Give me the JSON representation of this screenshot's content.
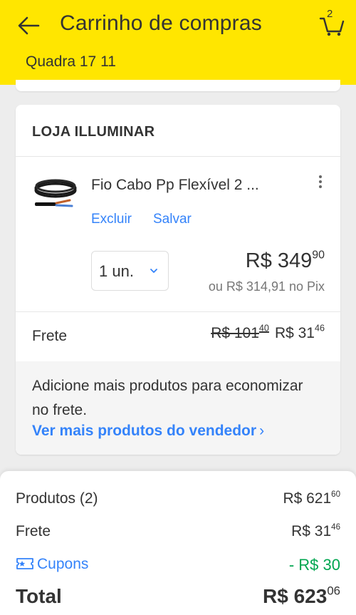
{
  "header": {
    "title": "Carrinho de compras",
    "cart_count": "2",
    "address": "Quadra 17 11",
    "bg_color": "#ffe600"
  },
  "store": {
    "name": "LOJA ILLUMINAR"
  },
  "product": {
    "name": "Fio Cabo Pp Flexível 2 ...",
    "delete_label": "Excluir",
    "save_label": "Salvar",
    "quantity": "1 un.",
    "price_main": "R$ 349",
    "price_cents": "90",
    "pix_price": "ou R$ 314,91 no Pix",
    "thumbnail_icon": "black-cable-thumbnail"
  },
  "shipping": {
    "label": "Frete",
    "old_price_main": "R$ 101",
    "old_price_cents": "40",
    "price_main": "R$ 31",
    "price_cents": "46"
  },
  "promo": {
    "text": "Adicione mais produtos para economizar no frete.",
    "link": "Ver mais produtos do vendedor",
    "link_icon": "chevron-right-icon"
  },
  "summary": {
    "products_label": "Produtos (2)",
    "products_main": "R$ 621",
    "products_cents": "60",
    "shipping_label": "Frete",
    "shipping_main": "R$ 31",
    "shipping_cents": "46",
    "coupons_label": "Cupons",
    "coupons_icon": "coupon-ticket-icon",
    "discount": "- R$ 30",
    "total_label": "Total",
    "total_main": "R$ 623",
    "total_cents": "06",
    "accent_color": "#3483fa",
    "discount_color": "#00a650"
  }
}
